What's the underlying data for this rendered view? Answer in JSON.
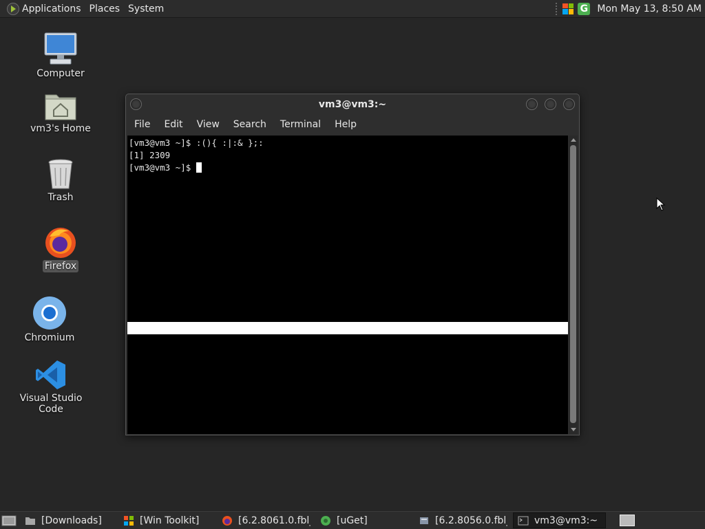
{
  "top_panel": {
    "menus": [
      "Applications",
      "Places",
      "System"
    ],
    "clock": "Mon May 13,  8:50 AM"
  },
  "desktop_icons": [
    {
      "label": "Computer"
    },
    {
      "label": "vm3's Home"
    },
    {
      "label": "Trash"
    },
    {
      "label": "Firefox"
    },
    {
      "label": "Chromium"
    },
    {
      "label": "Visual Studio Code"
    }
  ],
  "terminal": {
    "title": "vm3@vm3:~",
    "menu": [
      "File",
      "Edit",
      "View",
      "Search",
      "Terminal",
      "Help"
    ],
    "lines": [
      "[vm3@vm3 ~]$ :(){ :|:& };:",
      "[1] 2309",
      "[vm3@vm3 ~]$ "
    ]
  },
  "taskbar": {
    "tasks": [
      {
        "label": "[Downloads]",
        "icon": "folder-icon"
      },
      {
        "label": "[Win Toolkit]",
        "icon": "windows-icon"
      },
      {
        "label": "[6.2.8061.0.fbl_...",
        "icon": "firefox-icon"
      },
      {
        "label": "[uGet]",
        "icon": "uget-icon"
      },
      {
        "label": "[6.2.8056.0.fbl_...",
        "icon": "installer-icon"
      },
      {
        "label": "vm3@vm3:~",
        "icon": "terminal-icon",
        "active": true
      }
    ]
  }
}
